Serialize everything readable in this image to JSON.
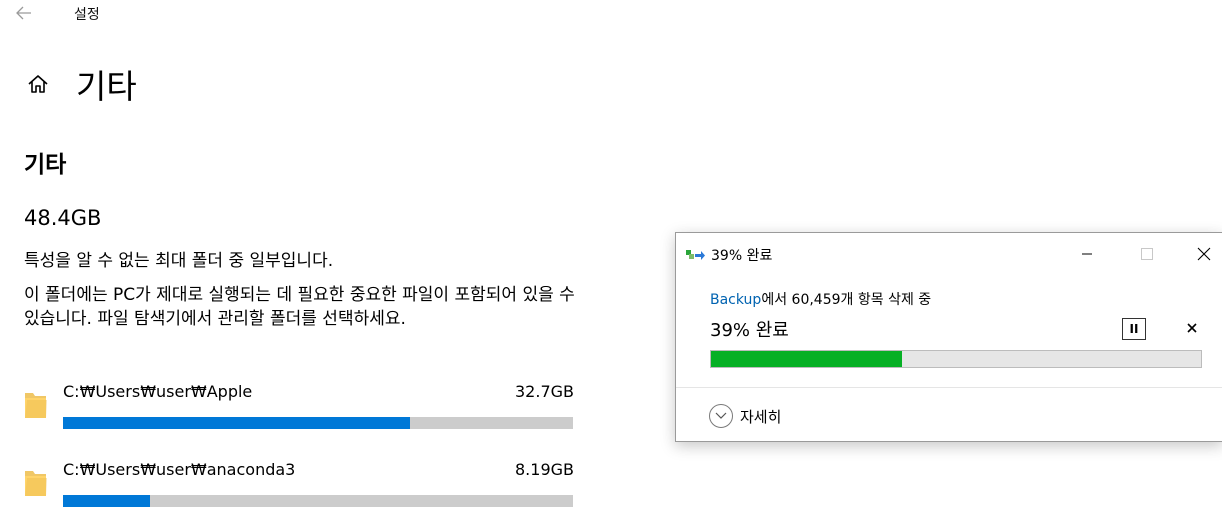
{
  "settings": {
    "app_title": "설정",
    "page_title": "기타",
    "section_title": "기타",
    "total_size": "48.4GB",
    "description_1": "특성을 알 수 없는 최대 폴더 중 일부입니다.",
    "description_2": "이 폴더에는 PC가 제대로 실행되는 데 필요한 중요한 파일이 포함되어 있을 수 있습니다. 파일 탐색기에서 관리할 폴더를 선택하세요.",
    "folders": [
      {
        "path": "C:₩Users₩user₩Apple",
        "size": "32.7GB",
        "usage_fraction": 0.68
      },
      {
        "path": "C:₩Users₩user₩anaconda3",
        "size": "8.19GB",
        "usage_fraction": 0.17
      }
    ],
    "accent_color": "#0078d7"
  },
  "dialog": {
    "title": "39% 완료",
    "status_source": "Backup",
    "status_rest": "에서 60,459개 항목 삭제 중",
    "progress_text": "39% 완료",
    "progress_fraction": 0.39,
    "pause_label": "II",
    "cancel_label": "×",
    "details_label": "자세히",
    "progress_color": "#06b025"
  }
}
